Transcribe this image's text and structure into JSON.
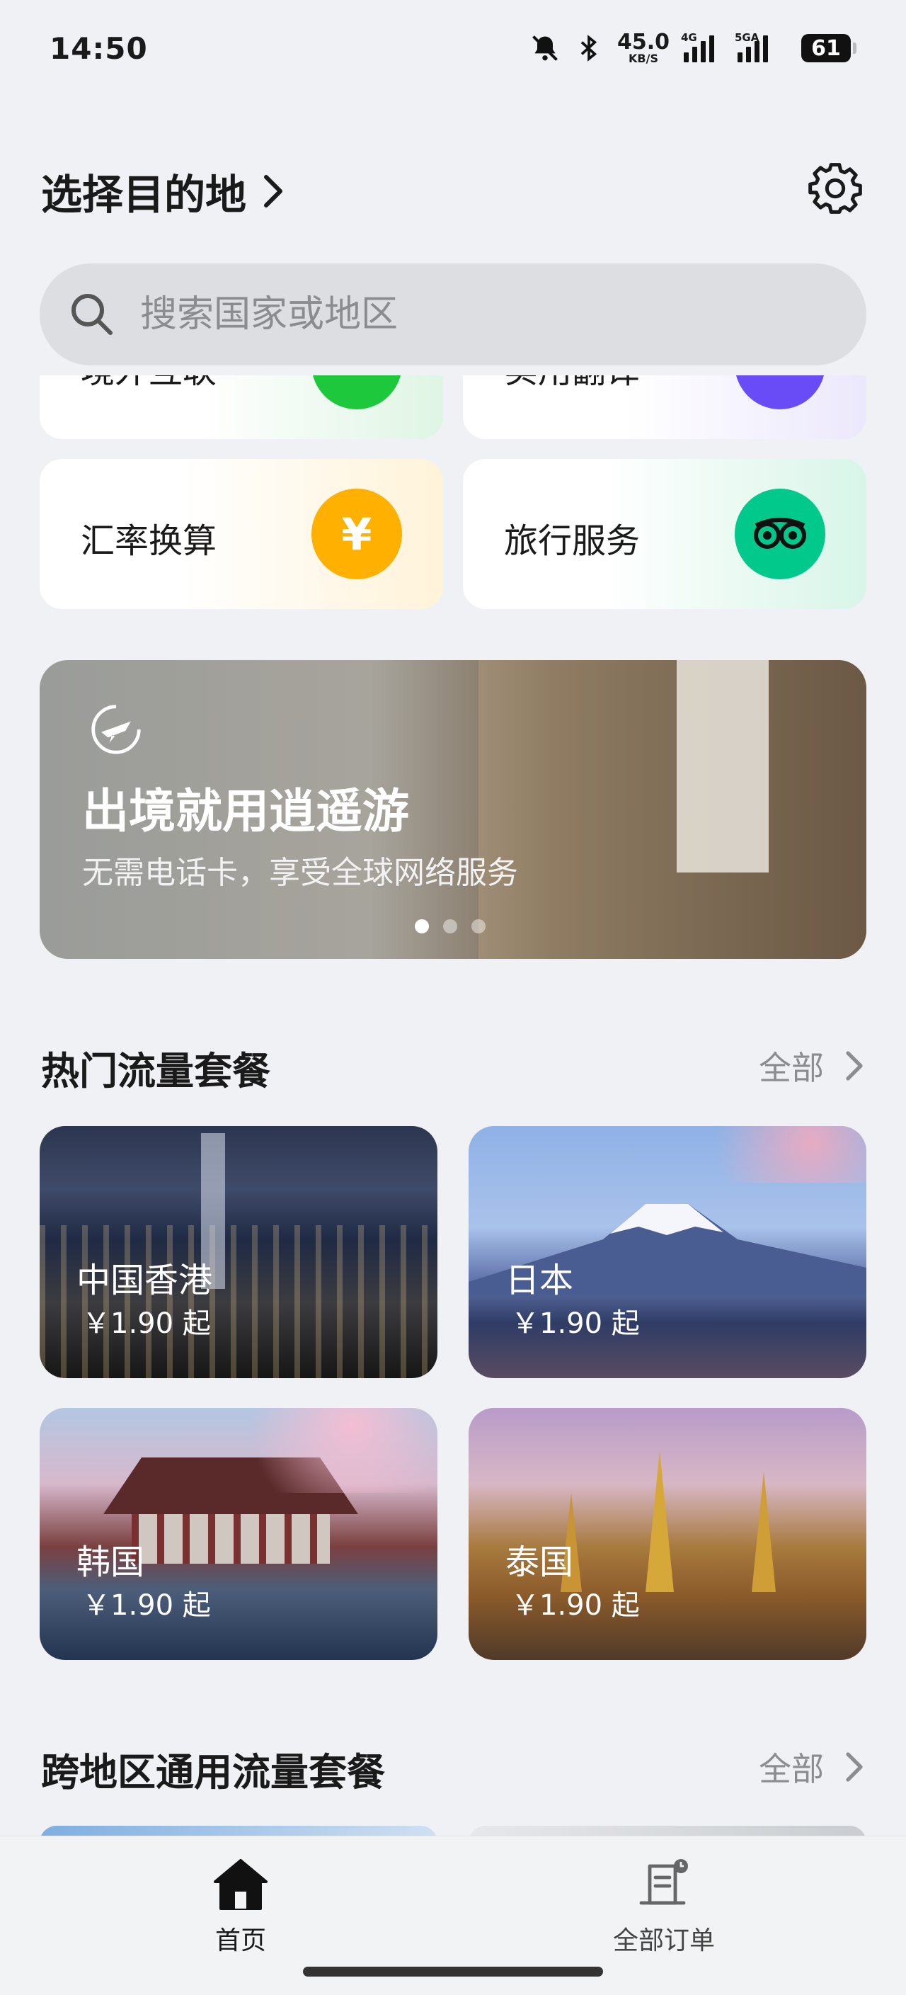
{
  "status": {
    "time": "14:50",
    "net_speed": "45.0",
    "net_unit": "KB/S",
    "sig1_tag": "4G",
    "sig2_tag": "5GA",
    "battery": "61"
  },
  "header": {
    "title": "选择目的地"
  },
  "search": {
    "placeholder": "搜索国家或地区"
  },
  "features": {
    "partial_left_label": "境外互联",
    "partial_right_label": "实用翻译",
    "exchange_label": "汇率换算",
    "exchange_icon_glyph": "¥",
    "travel_label": "旅行服务"
  },
  "banner": {
    "headline": "出境就用逍遥游",
    "subtitle": "无需电话卡，享受全球网络服务",
    "slides": 3,
    "active_slide": 0
  },
  "hot": {
    "title": "热门流量套餐",
    "all_label": "全部",
    "items": [
      {
        "name": "中国香港",
        "price": "￥1.90 起"
      },
      {
        "name": "日本",
        "price": "￥1.90 起"
      },
      {
        "name": "韩国",
        "price": "￥1.90 起"
      },
      {
        "name": "泰国",
        "price": "￥1.90 起"
      }
    ]
  },
  "cross": {
    "title": "跨地区通用流量套餐",
    "all_label": "全部"
  },
  "nav": {
    "home": "首页",
    "orders": "全部订单"
  },
  "colors": {
    "exchange_circle": "#ffb000",
    "travel_circle": "#00c98b",
    "partial_green": "#1ec83c",
    "partial_purple": "#6a4cf6"
  }
}
